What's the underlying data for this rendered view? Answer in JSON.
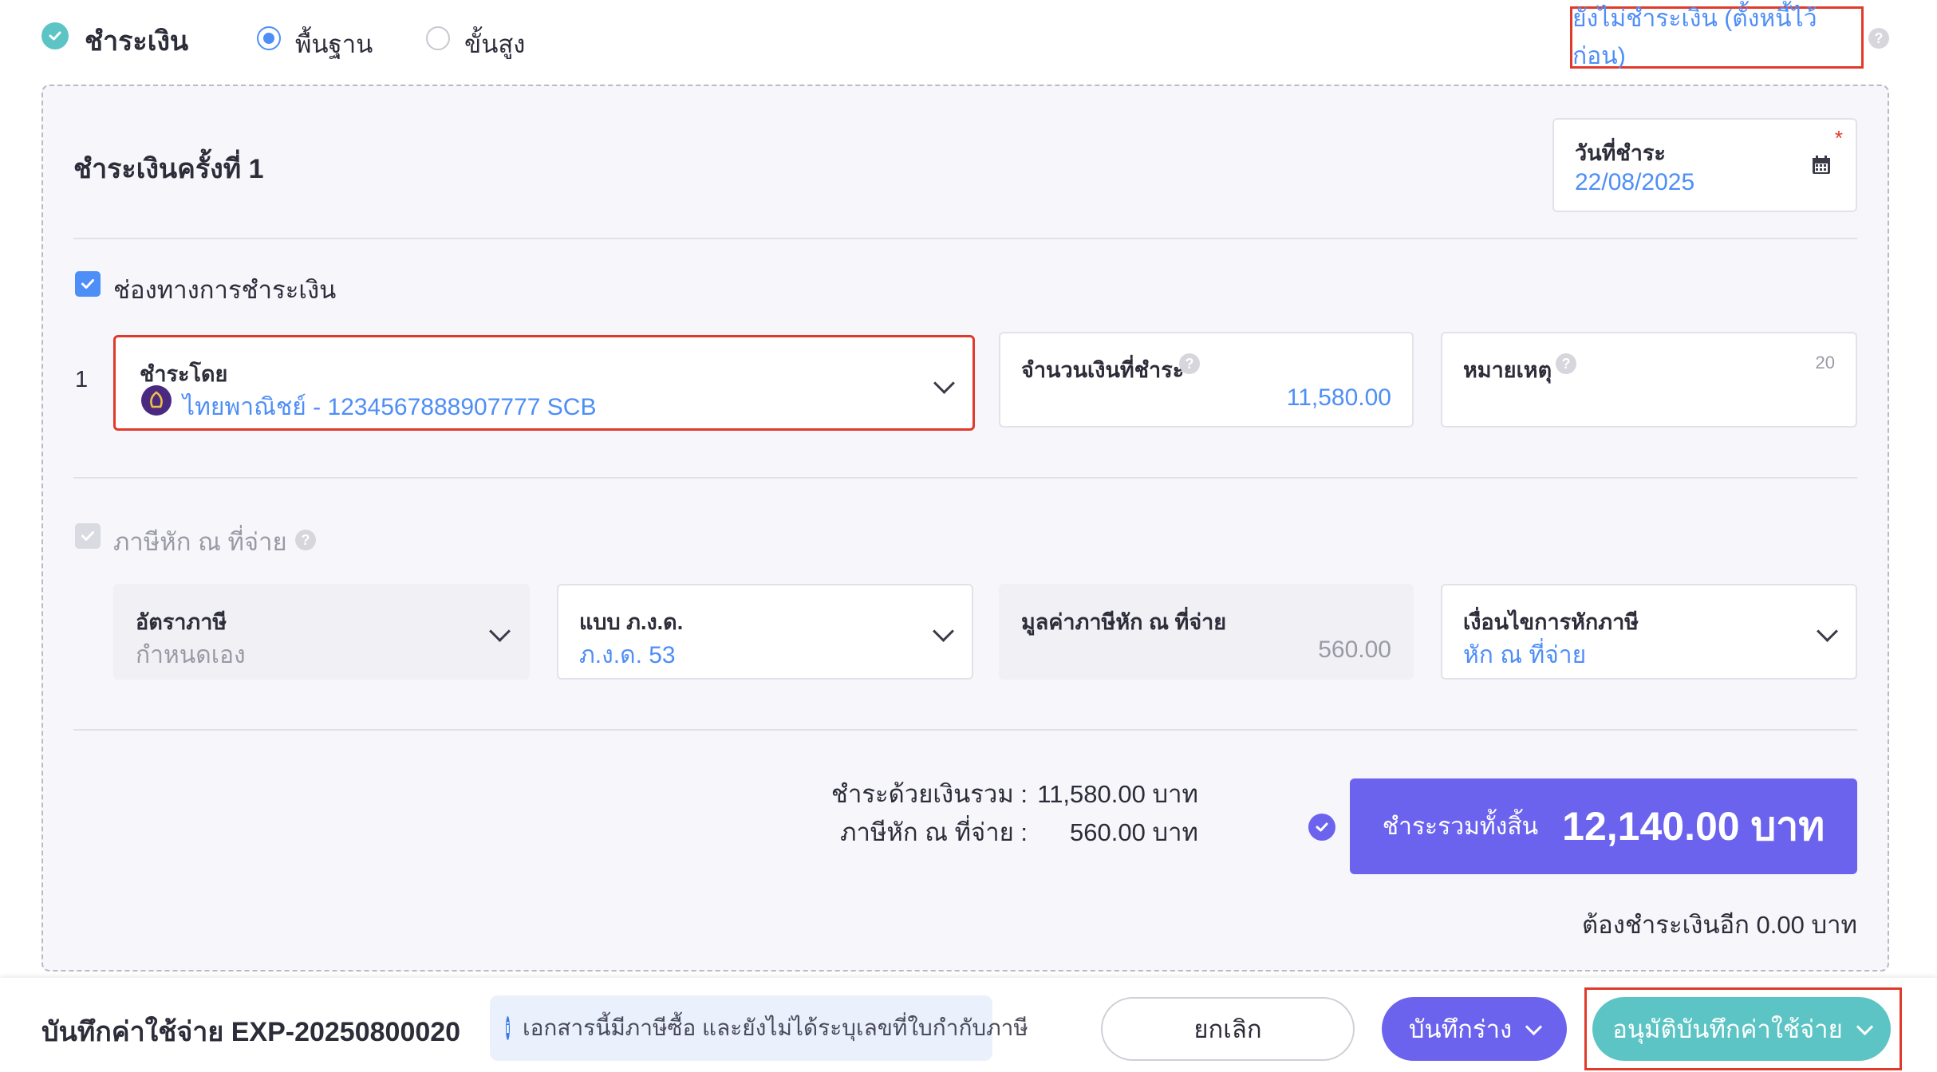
{
  "header": {
    "title": "ชำระเงิน",
    "mode_options": [
      "พื้นฐาน",
      "ขั้นสูง"
    ],
    "selected_mode": "พื้นฐาน",
    "unpaid_link": "ยังไม่ชำระเงิน (ตั้งหนี้ไว้ก่อน)"
  },
  "payment": {
    "section_title": "ชำระเงินครั้งที่ 1",
    "date_label": "วันที่ชำระ",
    "date_value": "22/08/2025",
    "channel_checkbox_label": "ช่องทางการชำระเงิน",
    "row_number": "1",
    "paid_by_label": "ชำระโดย",
    "paid_by_value": "ไทยพาณิชย์ - 1234567888907777 SCB",
    "amount_label": "จำนวนเงินที่ชำระ",
    "amount_value": "11,580.00",
    "note_label": "หมายเหตุ",
    "note_counter": "20"
  },
  "withholding": {
    "checkbox_label": "ภาษีหัก ณ ที่จ่าย",
    "rate_label": "อัตราภาษี",
    "rate_value": "กำหนดเอง",
    "form_label": "แบบ ภ.ง.ด.",
    "form_value": "ภ.ง.ด. 53",
    "wht_amount_label": "มูลค่าภาษีหัก ณ ที่จ่าย",
    "wht_amount_value": "560.00",
    "condition_label": "เงื่อนไขการหักภาษี",
    "condition_value": "หัก ณ ที่จ่าย"
  },
  "summary": {
    "paid_total_label": "ชำระด้วยเงินรวม :",
    "paid_total_value": "11,580.00 บาท",
    "wht_label": "ภาษีหัก ณ ที่จ่าย :",
    "wht_value": "560.00 บาท",
    "grand_label": "ชำระรวมทั้งสิ้น",
    "grand_value": "12,140.00 บาท",
    "remaining": "ต้องชำระเงินอีก 0.00 บาท"
  },
  "footer": {
    "doc_title": "บันทึกค่าใช้จ่าย EXP-20250800020",
    "info_text": "เอกสารนี้มีภาษีซื้อ และยังไม่ได้ระบุเลขที่ใบกำกับภาษี",
    "cancel_label": "ยกเลิก",
    "draft_label": "บันทึกร่าง",
    "approve_label": "อนุมัติบันทึกค่าใช้จ่าย"
  },
  "colors": {
    "accent_blue": "#4e8ef7",
    "primary_purple": "#6b63ee",
    "teal": "#5cc4c4",
    "highlight_red": "#e03a2a"
  }
}
